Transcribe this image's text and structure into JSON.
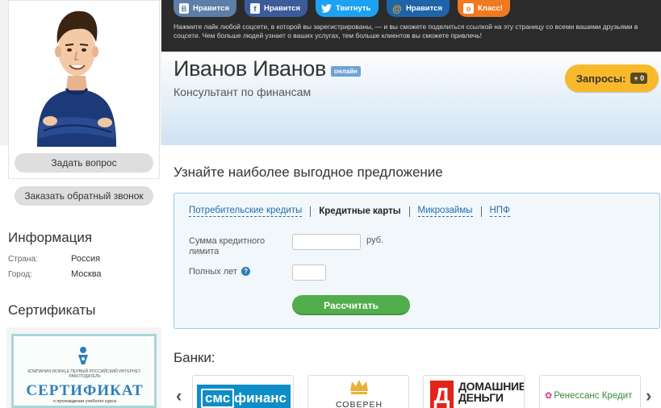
{
  "social": {
    "vk": {
      "icon": "В",
      "label": "Нравится"
    },
    "fb": {
      "icon": "f",
      "label": "Нравится"
    },
    "tw": {
      "label": "Твитнуть"
    },
    "mail": {
      "icon": "@",
      "label": "Нравится"
    },
    "ok": {
      "icon": "о",
      "label": "Класс!"
    }
  },
  "share_note": "Нажмите лайк любой соцсети, в которой вы зарегистрированы, — и вы сможете поделиться ссылкой на эту страницу со всеми вашими друзьями в соцсети. Чем больше людей узнает о ваших услугах, тем больше клиентов вы сможете привлечь!",
  "profile": {
    "name": "Иванов Иванов",
    "status": "онлайн",
    "profession": "Консультант по финансам"
  },
  "requests": {
    "label": "Запросы:",
    "count": "+ 0"
  },
  "sidebar": {
    "ask_button": "Задать вопрос",
    "callback_button": "Заказать обратный звонок",
    "info_title": "Информация",
    "country_label": "Страна:",
    "country_value": "Россия",
    "city_label": "Город:",
    "city_value": "Москва",
    "certs_title": "Сертификаты",
    "cert_org": "КОМПАНИЯ WORKLE ПЕРВЫЙ РОССИЙСКИЙ ИНТЕРНЕТ-РАБОТОДАТЕЛЬ",
    "cert_title": "СЕРТИФИКАТ",
    "cert_sub": "о прохождении учебного курса"
  },
  "offer": {
    "title": "Узнайте наиболее выгодное предложение",
    "tabs": [
      "Потребительские кредиты",
      "Кредитные карты",
      "Микрозаймы",
      "НПФ"
    ],
    "limit_label_1": "Сумма кредитного",
    "limit_label_2": "лимита",
    "limit_value": "",
    "unit": "руб.",
    "age_label": "Полных лет",
    "age_value": "",
    "help_icon": "?",
    "calc_button": "Рассчитать"
  },
  "banks": {
    "title": "Банки:",
    "prev": "‹",
    "next": "›",
    "sms_logo_1": "смс",
    "sms_logo_2": "финанс",
    "sovcom": "СОВЕРЕН",
    "dd_mark": "Д",
    "dd_line1": "ДОМАШНИЕ",
    "dd_line2": "ДЕНЬГИ",
    "ren": "Ренессанс Кредит"
  }
}
